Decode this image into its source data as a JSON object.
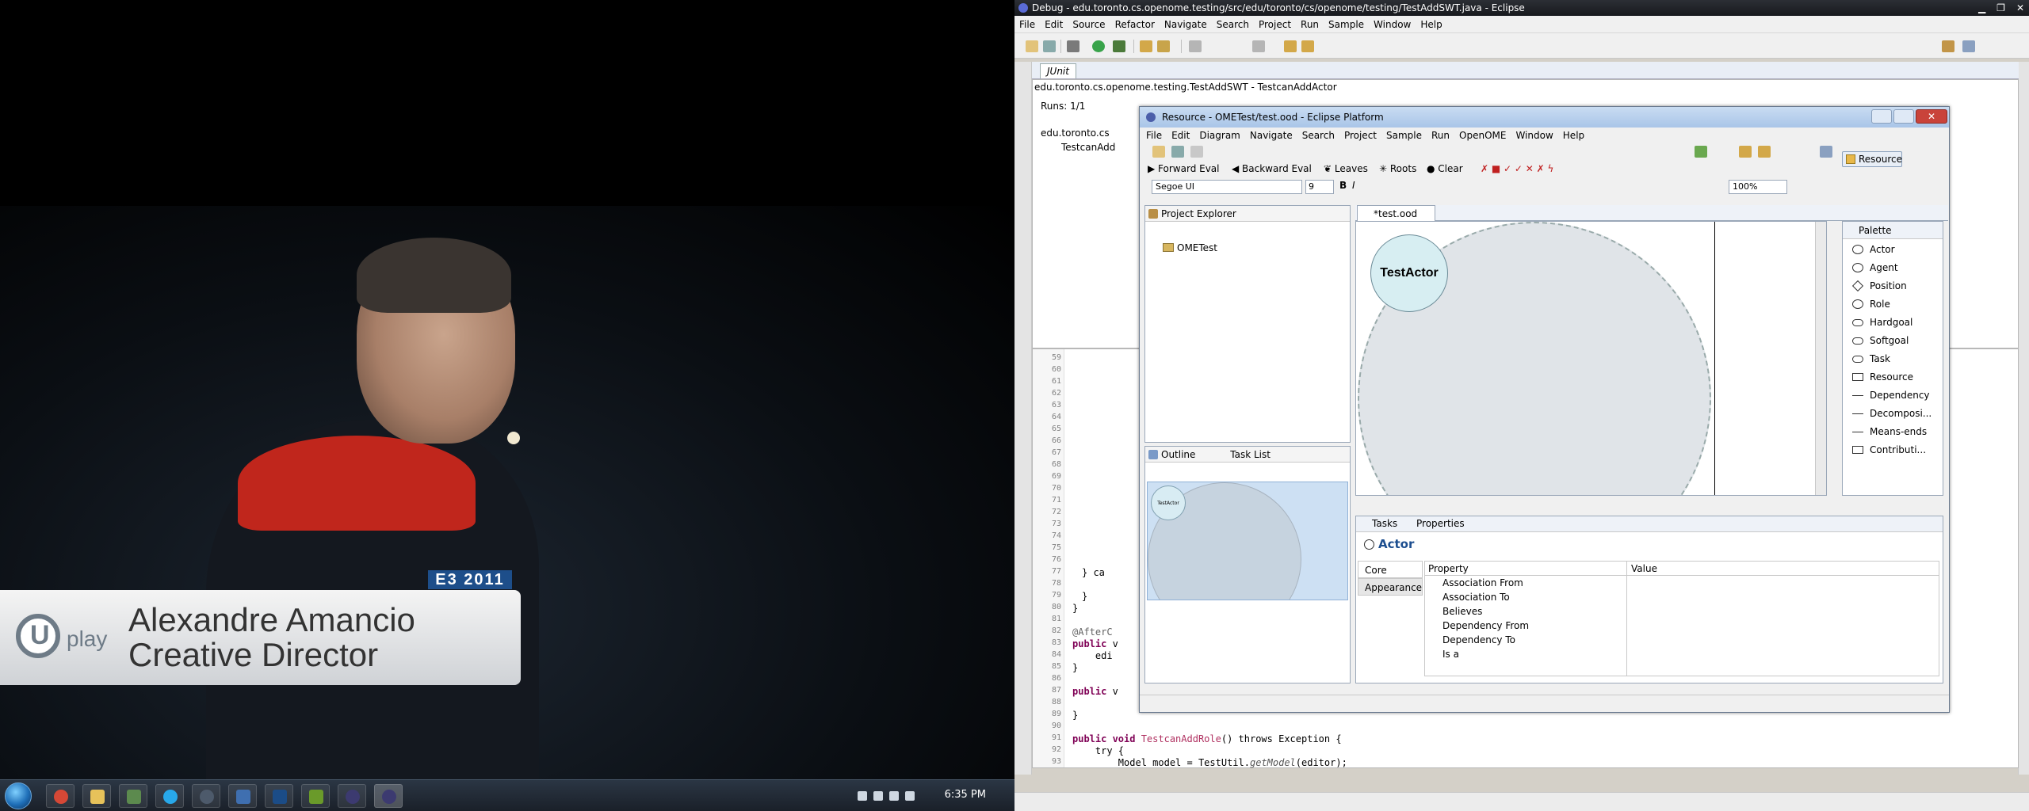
{
  "video": {
    "event_tag": "E3 2011",
    "brand_letter": "U",
    "brand_word": "play",
    "presenter_name": "Alexandre Amancio",
    "presenter_role": "Creative Director"
  },
  "taskbar": {
    "clock": "6:35 PM",
    "icons": [
      "chrome-icon",
      "explorer-icon",
      "network-icon",
      "skype-icon",
      "steam-icon",
      "app-icon",
      "photoshop-icon",
      "media-icon",
      "eclipse-icon",
      "eclipse-icon-2"
    ]
  },
  "eclipse": {
    "title": "Debug - edu.toronto.cs.openome.testing/src/edu/toronto/cs/openome/testing/TestAddSWT.java - Eclipse",
    "menu": [
      "File",
      "Edit",
      "Source",
      "Refactor",
      "Navigate",
      "Search",
      "Project",
      "Run",
      "Sample",
      "Window",
      "Help"
    ],
    "junit": {
      "tab_label": "JUnit",
      "path": "edu.toronto.cs.openome.testing.TestAddSWT - TestcanAddActor",
      "runs": "Runs:  1/1",
      "tree_root": "edu.toronto.cs",
      "tree_child": "TestcanAdd"
    },
    "editor": {
      "line_numbers": [
        "59",
        "60",
        "61",
        "62",
        "63",
        "64",
        "65",
        "66",
        "67",
        "68",
        "69",
        "70",
        "71",
        "72",
        "73",
        "74",
        "75",
        "76",
        "77",
        "78",
        "79",
        "80",
        "81",
        "82",
        "83",
        "84",
        "85",
        "86",
        "87",
        "88",
        "89",
        "90",
        "91",
        "92",
        "93"
      ],
      "lines": {
        "l77": "} ca",
        "l79": "}",
        "l80": "}",
        "l82": "@AfterC",
        "l83_kw": "public",
        "l83": " v",
        "l84": "    edi",
        "l85": "}",
        "l87_kw": "public",
        "l87": " v",
        "l89": "}",
        "l91_kw1": "public void ",
        "l91_name": "TestcanAddRole",
        "l91_rest": "() throws Exception {",
        "l92": "    try {",
        "l93_pre": "        Model model = TestUtil.",
        "l93_it": "getModel",
        "l93_post": "(editor);"
      }
    }
  },
  "resource": {
    "title": "Resource - OMETest/test.ood - Eclipse Platform",
    "menu": [
      "File",
      "Edit",
      "Diagram",
      "Navigate",
      "Search",
      "Project",
      "Sample",
      "Run",
      "OpenOME",
      "Window",
      "Help"
    ],
    "toolbar2": {
      "forward_eval": "Forward Eval",
      "backward_eval": "Backward Eval",
      "leaves": "Leaves",
      "roots": "Roots",
      "clear": "Clear"
    },
    "font_name": "Segoe UI",
    "font_size": "9",
    "zoom": "100%",
    "perspective_button": "Resource",
    "project_explorer": {
      "tab": "Project Explorer",
      "items": [
        "OMETest"
      ]
    },
    "outline": {
      "tab1": "Outline",
      "tab2": "Task List",
      "actor_label": "TestActor"
    },
    "diagram": {
      "tab": "*test.ood",
      "actor_label": "TestActor"
    },
    "palette": {
      "title": "Palette",
      "items": [
        {
          "label": "Actor",
          "shape": "circ"
        },
        {
          "label": "Agent",
          "shape": "circ"
        },
        {
          "label": "Position",
          "shape": "hex"
        },
        {
          "label": "Role",
          "shape": "circ"
        },
        {
          "label": "Hardgoal",
          "shape": "pill"
        },
        {
          "label": "Softgoal",
          "shape": "pill"
        },
        {
          "label": "Task",
          "shape": "pill"
        },
        {
          "label": "Resource",
          "shape": "rect"
        },
        {
          "label": "Dependency",
          "shape": "arrow"
        },
        {
          "label": "Decomposi...",
          "shape": "arrow"
        },
        {
          "label": "Means-ends",
          "shape": "arrow"
        },
        {
          "label": "Contributi...",
          "shape": "folder"
        }
      ]
    },
    "properties": {
      "tab1": "Tasks",
      "tab2": "Properties",
      "selection": "Actor",
      "section_core": "Core",
      "section_appearance": "Appearance",
      "col_property": "Property",
      "col_value": "Value",
      "rows": [
        "Association From",
        "Association To",
        "Believes",
        "Dependency From",
        "Dependency To",
        "Is a"
      ]
    }
  }
}
